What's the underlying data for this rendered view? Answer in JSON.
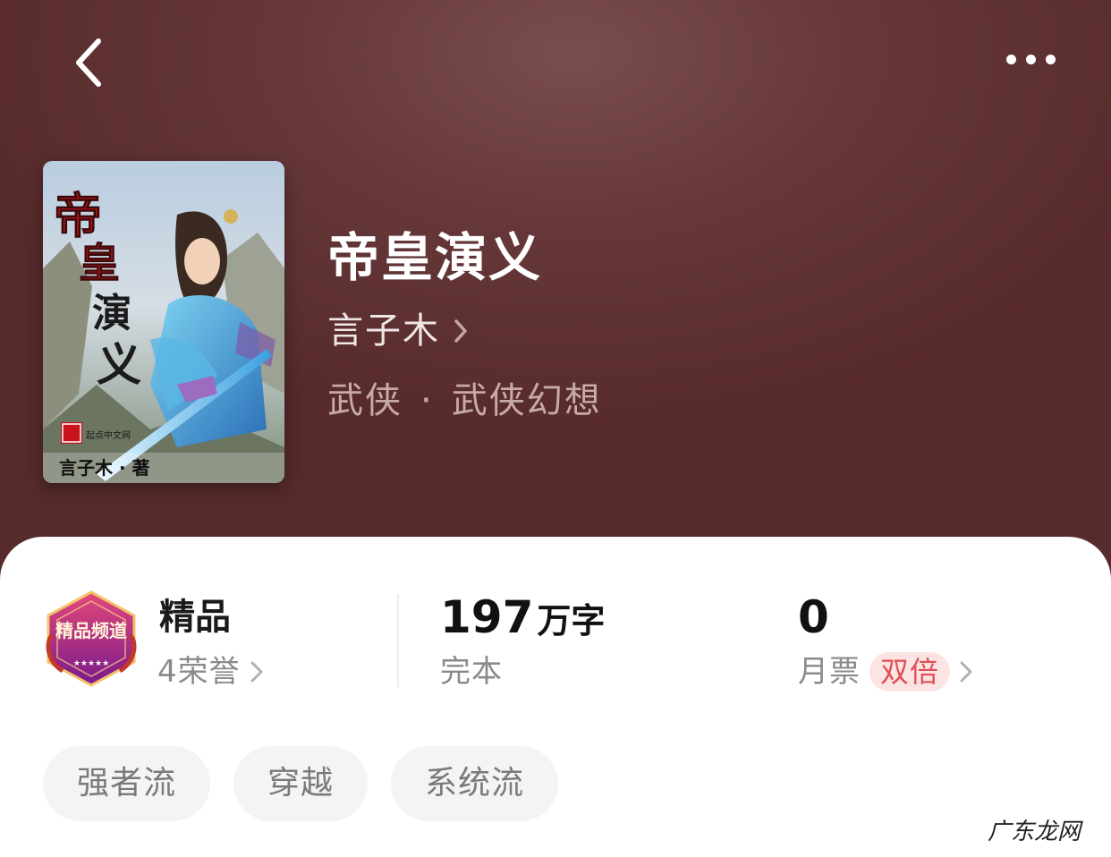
{
  "book": {
    "title": "帝皇演义",
    "author": "言子木",
    "genre": "武侠",
    "separator": "·",
    "subgenre": "武侠幻想"
  },
  "cover": {
    "title_chars": [
      "帝",
      "皇",
      "演",
      "义"
    ],
    "author_credit": "言子木 · 著",
    "publisher": "起点中文网"
  },
  "honor": {
    "badge_text": "精品频道",
    "label": "精品",
    "count": "4荣誉"
  },
  "wordcount": {
    "number": "197",
    "unit": "万字",
    "status": "完本"
  },
  "monthly_ticket": {
    "count": "0",
    "label": "月票",
    "badge": "双倍"
  },
  "tags": [
    "强者流",
    "穿越",
    "系统流"
  ],
  "watermark": "广东龙网",
  "colors": {
    "header_bg": "#5c2f30",
    "double_badge_bg": "#fde4e4",
    "double_badge_text": "#e04f55"
  }
}
